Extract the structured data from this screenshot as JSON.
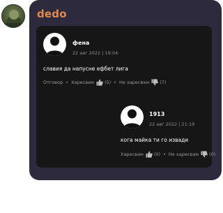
{
  "profile": {
    "username": "dedo"
  },
  "comments": [
    {
      "author": "фена",
      "date": "22 авг 2022 | 19:04",
      "text": "славия да напусне ефбет лига",
      "reply_label": "Отговор",
      "like_label": "Харесвам",
      "like_count": "(5)",
      "dislike_label": "Не харесвам",
      "dislike_count": "(7)"
    },
    {
      "author": "1913",
      "date": "22 авг 2022 | 21:19",
      "text": "кога майка ти го извади",
      "like_label": "Харесвам",
      "like_count": "(0)",
      "dislike_label": "Не харесвам",
      "dislike_count": "(0)"
    }
  ],
  "colors": {
    "panel_bg": "#2e2a3d",
    "thread_bg": "#161616",
    "username": "#e28a4c"
  }
}
